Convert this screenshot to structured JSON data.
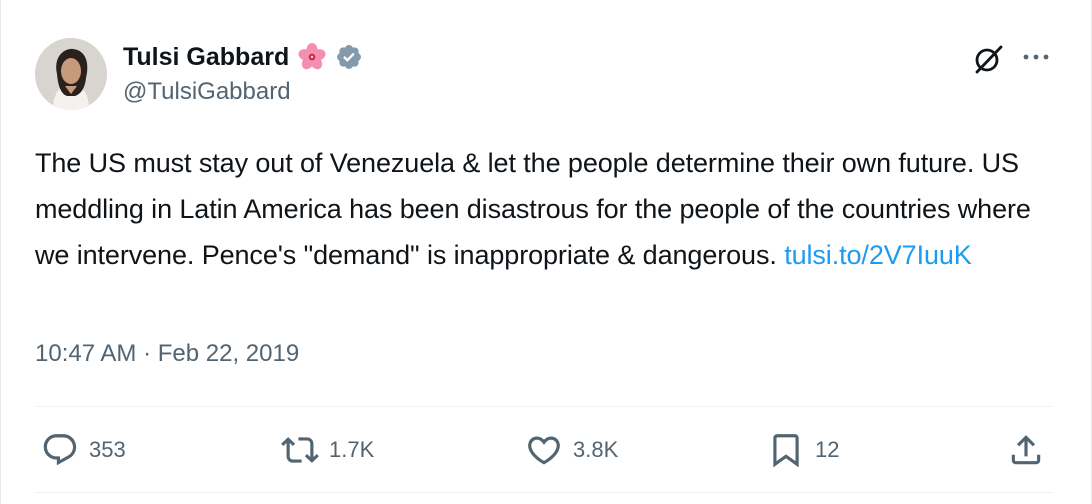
{
  "author": {
    "display_name": "Tulsi Gabbard",
    "handle": "@TulsiGabbard",
    "emoji": "hibiscus-flower",
    "verified_badge": "verified-badge-icon"
  },
  "tweet": {
    "text": "The US must stay out of Venezuela & let the people determine their own future. US meddling in Latin America has been disastrous for the people of the countries where we intervene. Pence's \"demand\" is inappropriate & dangerous. ",
    "link_text": "tulsi.to/2V7IuuK",
    "timestamp": "10:47 AM · Feb 22, 2019"
  },
  "actions": {
    "replies": "353",
    "reposts": "1.7K",
    "likes": "3.8K",
    "bookmarks": "12"
  },
  "colors": {
    "text": "#0f1419",
    "secondary": "#536471",
    "link": "#1d9bf0",
    "verified": "#829aab"
  },
  "icons": [
    "grok-icon",
    "more-icon",
    "reply-icon",
    "repost-icon",
    "like-icon",
    "bookmark-icon",
    "share-icon"
  ]
}
